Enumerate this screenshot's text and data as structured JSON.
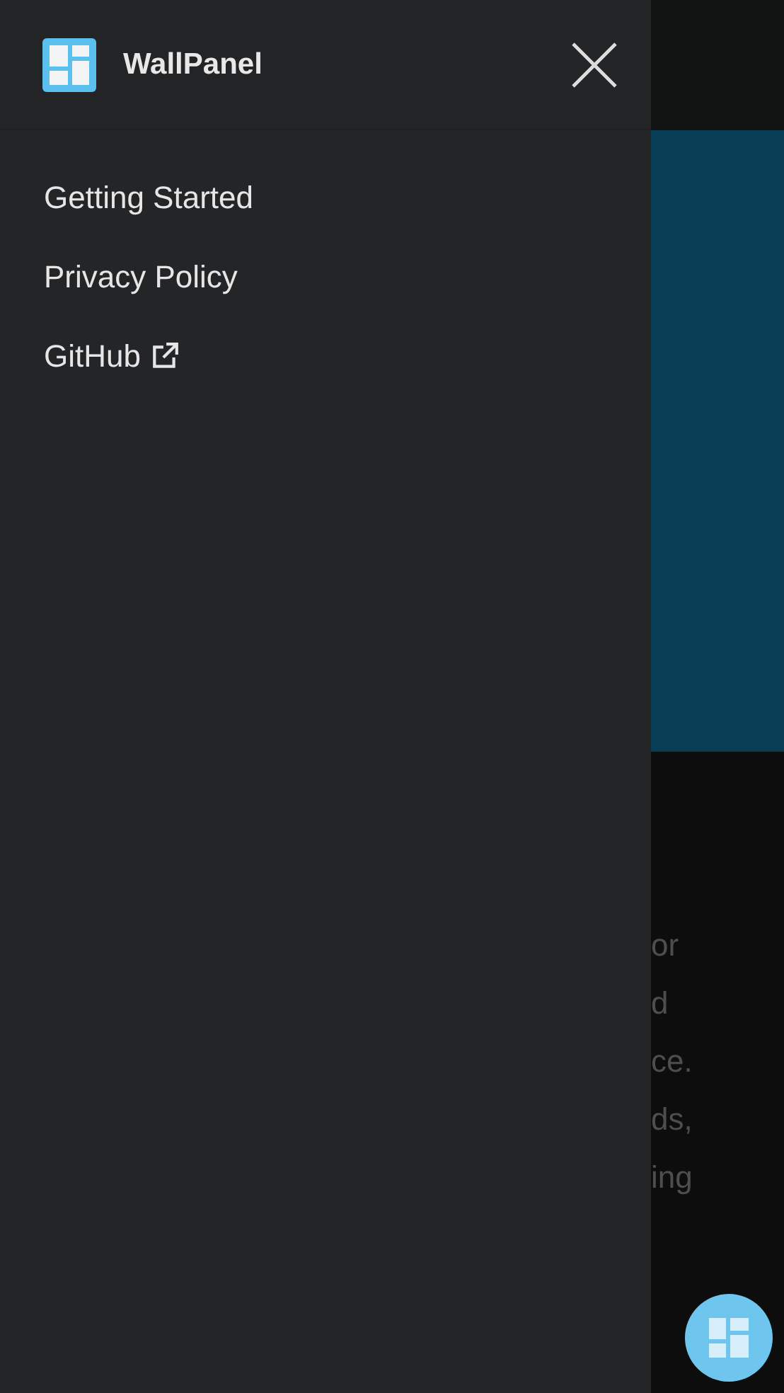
{
  "drawer": {
    "title": "WallPanel",
    "items": [
      {
        "label": "Getting Started",
        "external": false
      },
      {
        "label": "Privacy Policy",
        "external": false
      },
      {
        "label": "GitHub",
        "external": true
      }
    ]
  },
  "page_behind": {
    "text_fragments": [
      "or",
      "d",
      "ce.",
      "ds,",
      "ing"
    ]
  }
}
